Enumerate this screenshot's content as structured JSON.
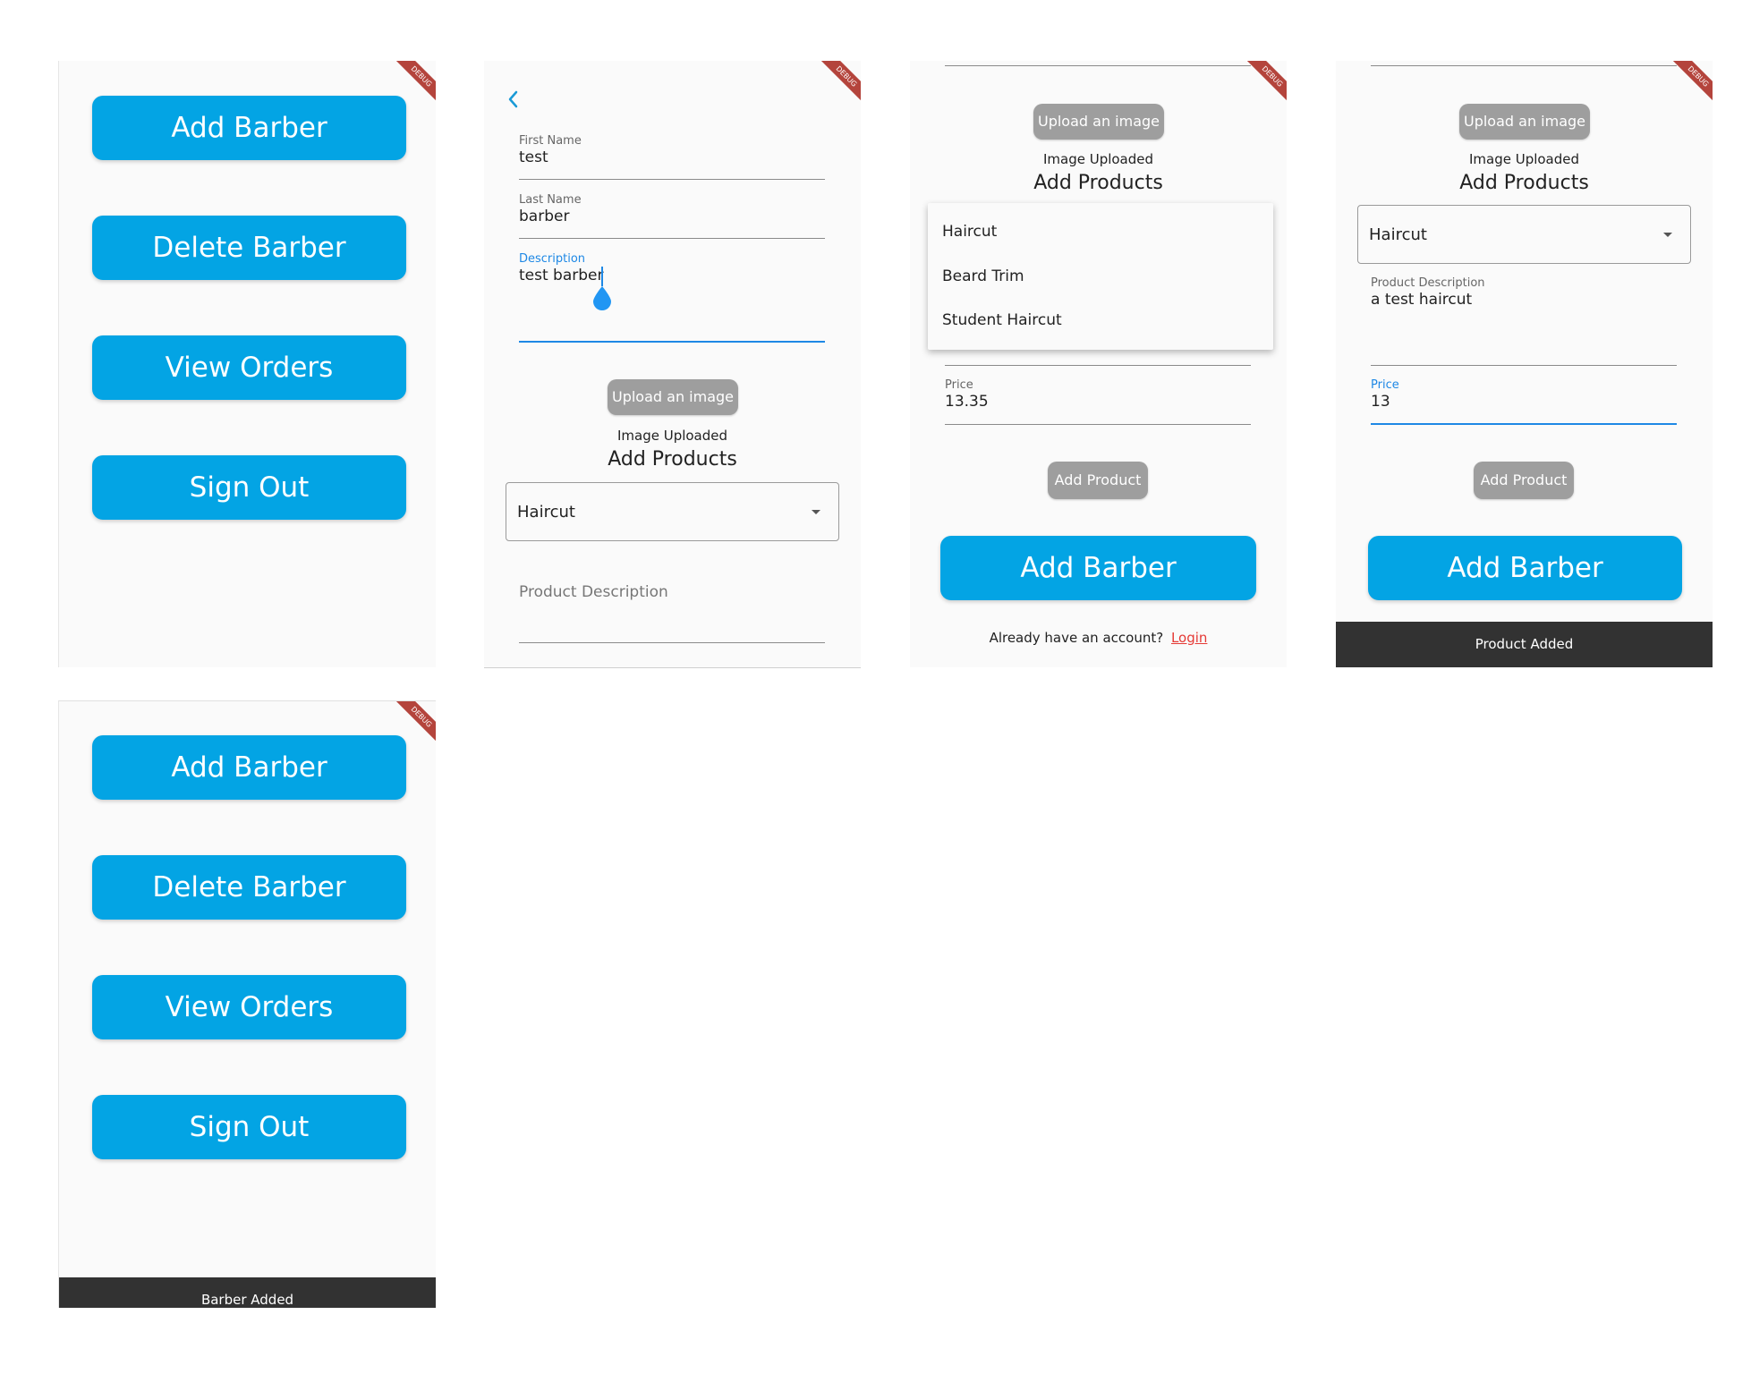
{
  "debug_banner": "DEBUG",
  "home": {
    "add_barber": "Add Barber",
    "delete_barber": "Delete Barber",
    "view_orders": "View Orders",
    "sign_out": "Sign Out"
  },
  "form": {
    "first_name_label": "First Name",
    "first_name_value": "test",
    "last_name_label": "Last Name",
    "last_name_value": "barber",
    "description_label": "Description",
    "description_value": "test barber",
    "upload_button": "Upload an image",
    "image_status": "Image Uploaded",
    "add_products_title": "Add Products",
    "product_select_value": "Haircut",
    "product_description_placeholder": "Product Description",
    "product_description_label": "Product Description",
    "product_description_value": "a test haircut",
    "price_label": "Price",
    "price_value_a": "13.35",
    "price_value_b": "13",
    "add_product_button": "Add Product",
    "add_barber_button": "Add Barber",
    "already_account": "Already have an account?",
    "login_link": "Login"
  },
  "product_options": [
    "Haircut",
    "Beard Trim",
    "Student Haircut"
  ],
  "snackbars": {
    "product_added": "Product Added",
    "barber_added": "Barber Added"
  },
  "colors": {
    "primary_button": "#03a4e4",
    "focus_blue": "#1e88e5",
    "login_link": "#e53935",
    "snackbar": "#323232"
  }
}
